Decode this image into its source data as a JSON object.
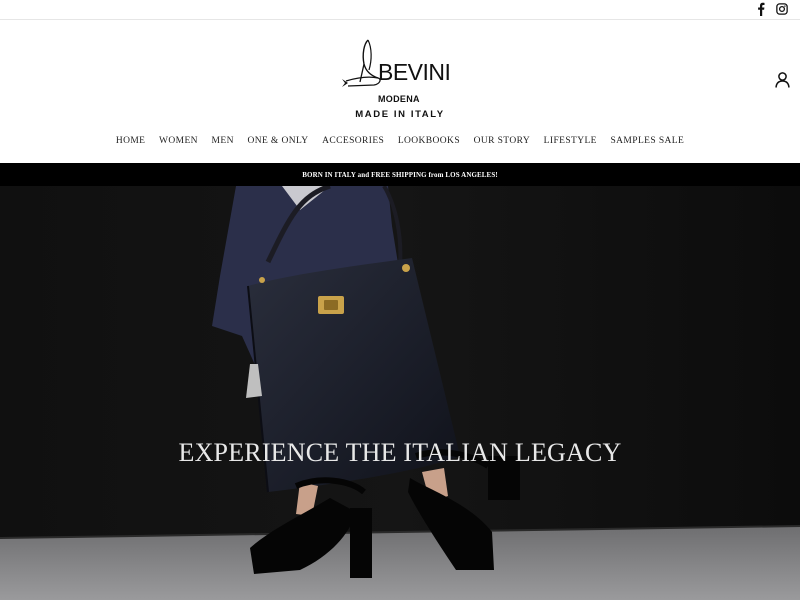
{
  "social": {
    "facebook_icon": "facebook-icon",
    "instagram_icon": "instagram-icon"
  },
  "brand": {
    "name": "BEVINI",
    "city": "MODENA",
    "tagline": "MADE IN ITALY"
  },
  "nav": {
    "items": [
      {
        "label": "HOME"
      },
      {
        "label": "WOMEN"
      },
      {
        "label": "MEN"
      },
      {
        "label": "ONE & ONLY"
      },
      {
        "label": "ACCESORIES"
      },
      {
        "label": "LOOKBOOKS"
      },
      {
        "label": "OUR STORY"
      },
      {
        "label": "LIFESTYLE"
      },
      {
        "label": "SAMPLES SALE"
      }
    ]
  },
  "announcement": {
    "text": "BORN IN ITALY and FREE SHIPPING from LOS ANGELES!"
  },
  "hero": {
    "headline": "EXPERIENCE THE ITALIAN LEGACY"
  },
  "colors": {
    "announcement_bg": "#000000",
    "hero_bg": "#111111",
    "text": "#222222"
  }
}
